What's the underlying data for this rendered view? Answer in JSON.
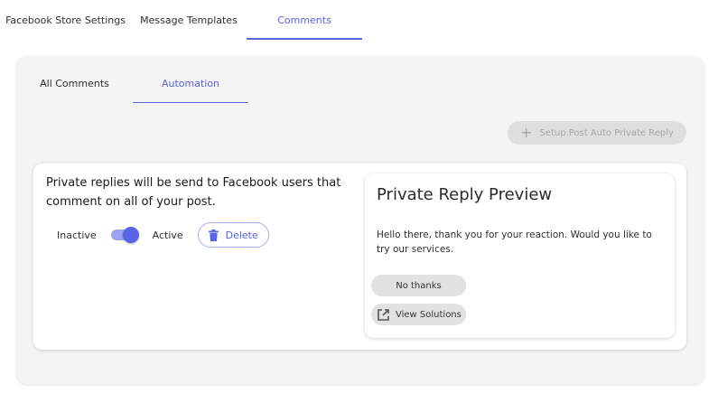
{
  "top_tabs": [
    {
      "label": "Facebook Store Settings"
    },
    {
      "label": "Message Templates"
    },
    {
      "label": "Comments"
    }
  ],
  "sub_tabs": [
    {
      "label": "All Comments"
    },
    {
      "label": "Automation"
    }
  ],
  "setup_button": {
    "label": "Setup Post Auto Private Reply",
    "icon": "plus-icon"
  },
  "rule": {
    "description": "Private replies will be send to Facebook users that comment on all of your post.",
    "inactive_label": "Inactive",
    "active_label": "Active",
    "toggle_on": true,
    "delete_label": "Delete",
    "delete_icon": "trash-icon"
  },
  "preview": {
    "title": "Private Reply Preview",
    "message": "Hello there, thank you for your reaction. Would you like to try our services.",
    "no_thanks_label": "No thanks",
    "view_solutions_label": "View Solutions",
    "view_icon": "external-link-icon"
  },
  "colors": {
    "accent": "#5a62e6",
    "accent_light": "#9ea2f0",
    "panel_bg": "#f4f4f4"
  }
}
